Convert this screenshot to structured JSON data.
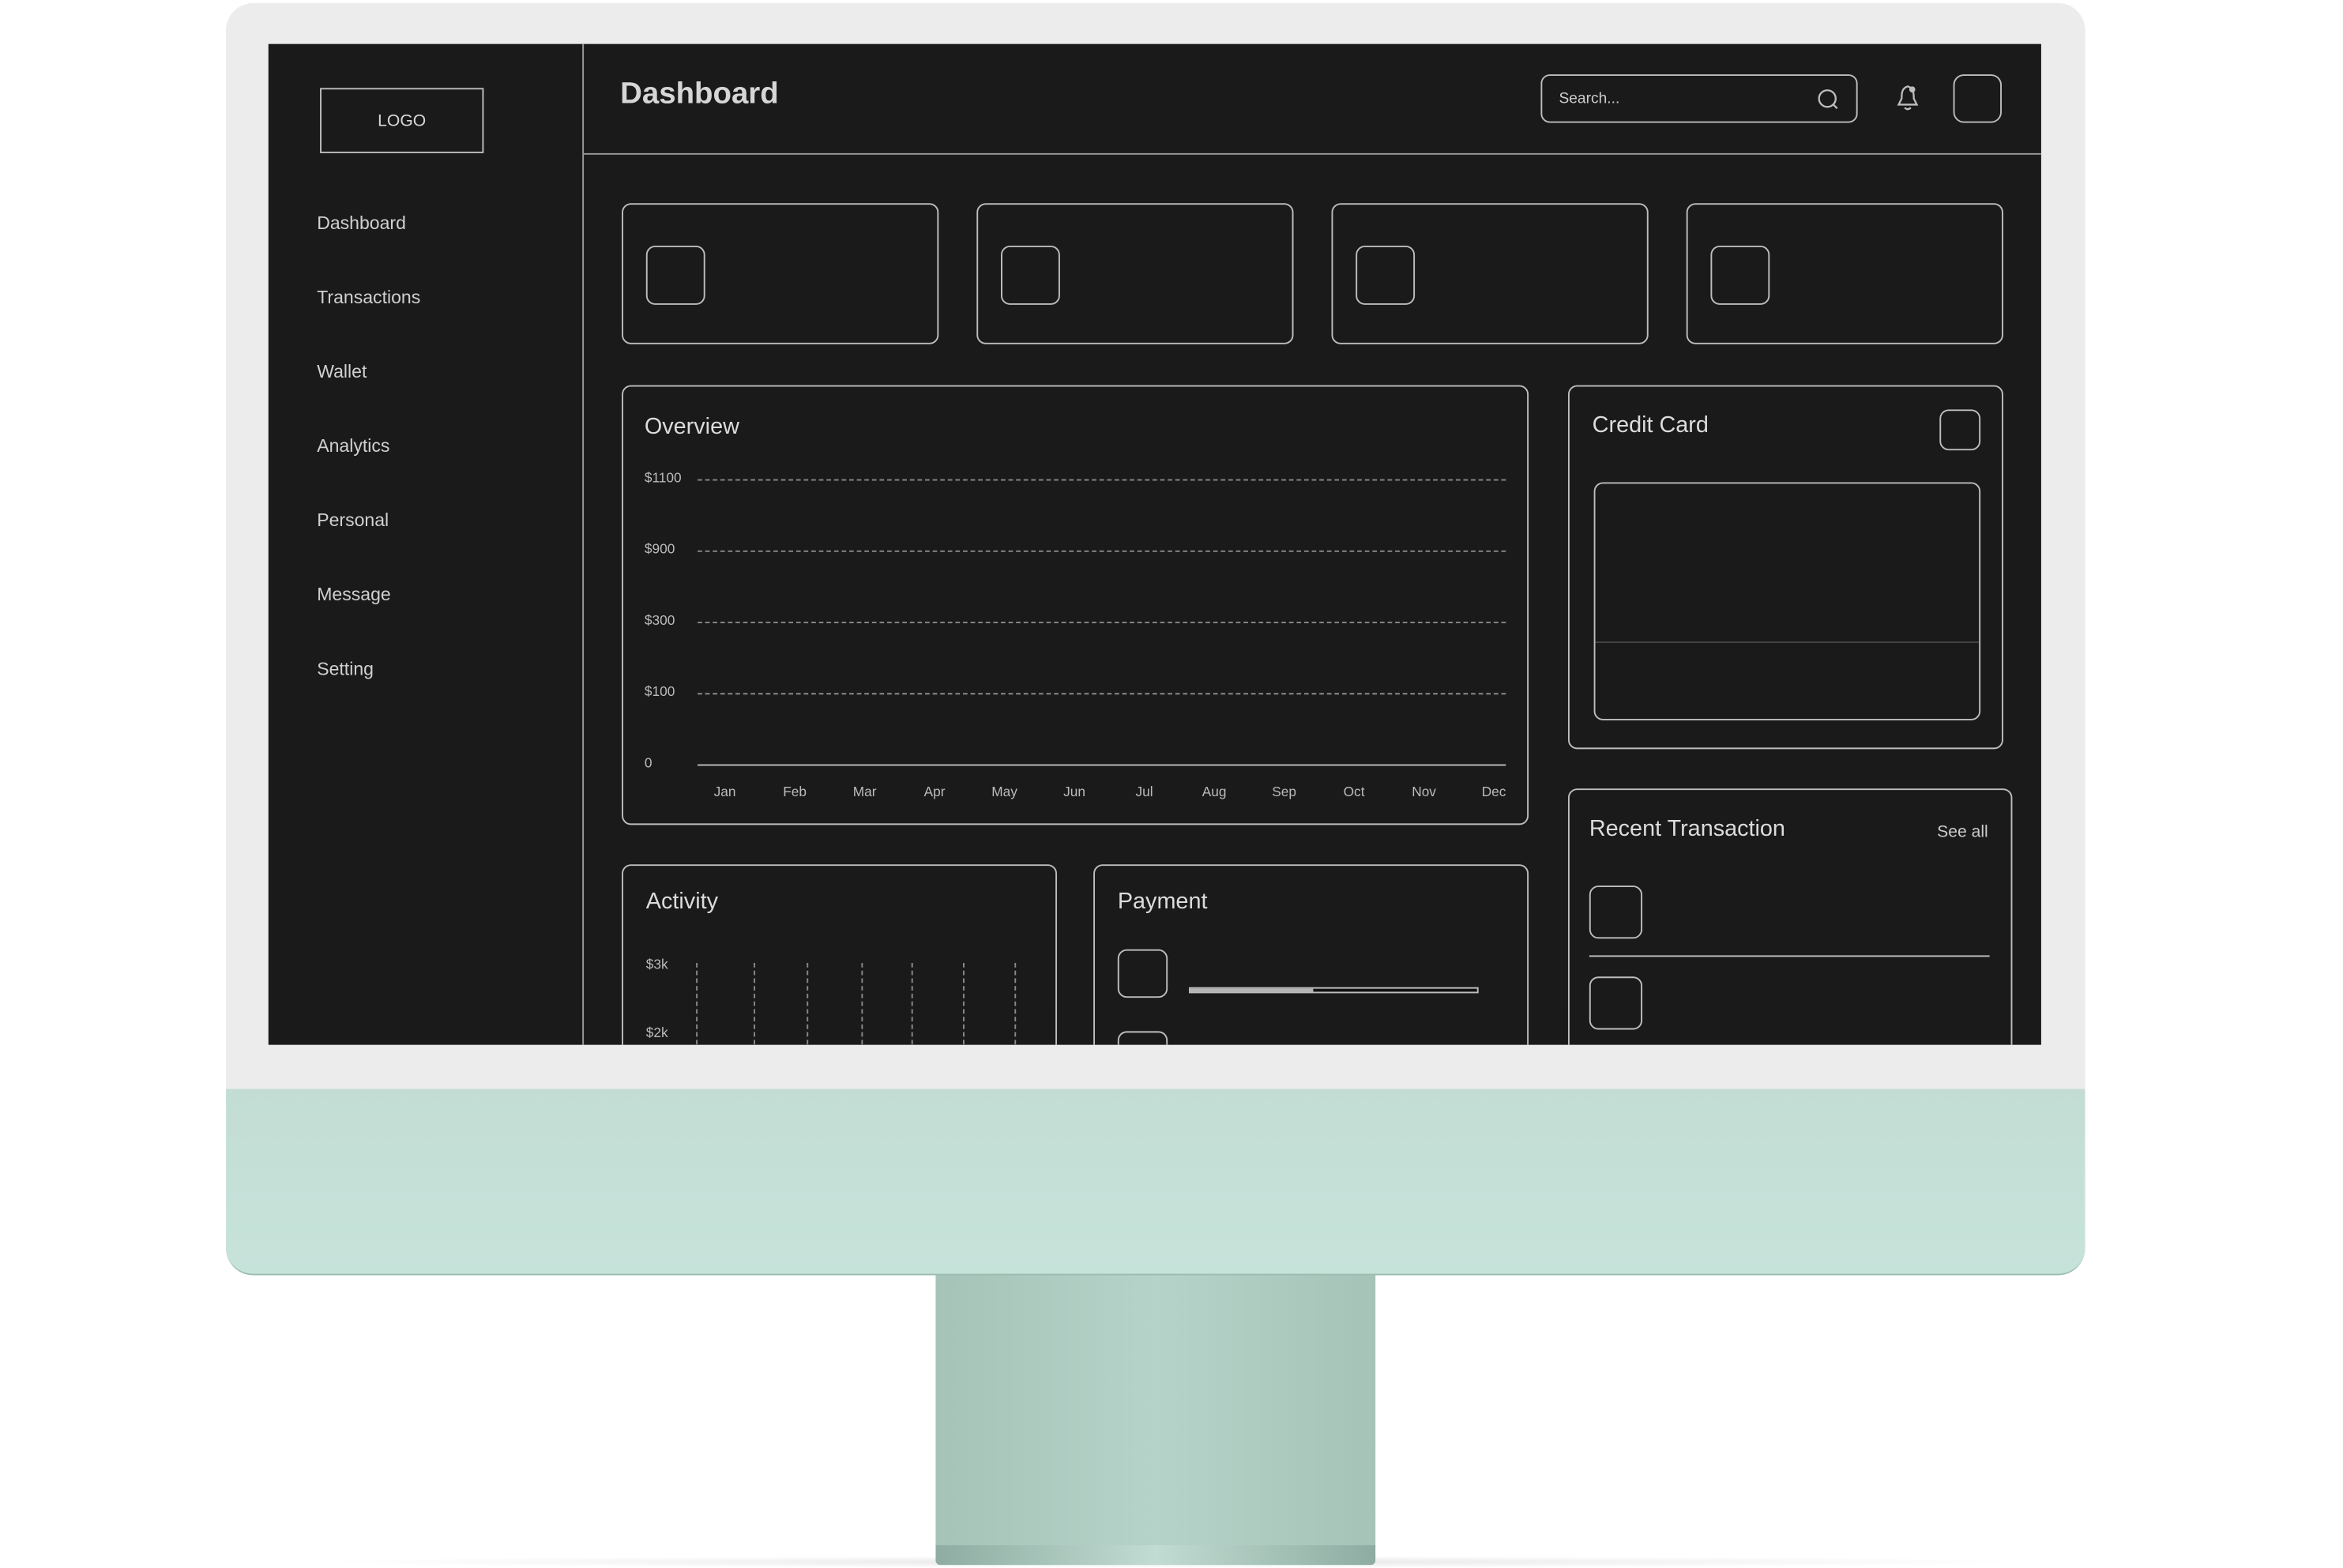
{
  "colors": {
    "screen_bg": "#1a1a1a",
    "outline": "#bdbdbd",
    "bezel": "#ececec",
    "chin": "#c3ddd4",
    "stand": "#aac8bd"
  },
  "sidebar": {
    "logo": "LOGO",
    "items": [
      {
        "label": "Dashboard"
      },
      {
        "label": "Transactions"
      },
      {
        "label": "Wallet"
      },
      {
        "label": "Analytics"
      },
      {
        "label": "Personal"
      },
      {
        "label": "Message"
      },
      {
        "label": "Setting"
      }
    ]
  },
  "header": {
    "title": "Dashboard",
    "search_placeholder": "Search...",
    "icons": [
      "search-icon",
      "bell-icon",
      "avatar"
    ]
  },
  "overview": {
    "title": "Overview",
    "y_ticks": [
      "$1100",
      "$900",
      "$300",
      "$100",
      "0"
    ],
    "x_ticks": [
      "Jan",
      "Feb",
      "Mar",
      "Apr",
      "May",
      "Jun",
      "Jul",
      "Aug",
      "Sep",
      "Oct",
      "Nov",
      "Dec"
    ]
  },
  "credit_card": {
    "title": "Credit Card"
  },
  "recent_transaction": {
    "title": "Recent Transaction",
    "see_all": "See all"
  },
  "activity": {
    "title": "Activity",
    "y_ticks": [
      "$3k",
      "$2k"
    ]
  },
  "payment": {
    "title": "Payment",
    "progress_percent": 43
  }
}
